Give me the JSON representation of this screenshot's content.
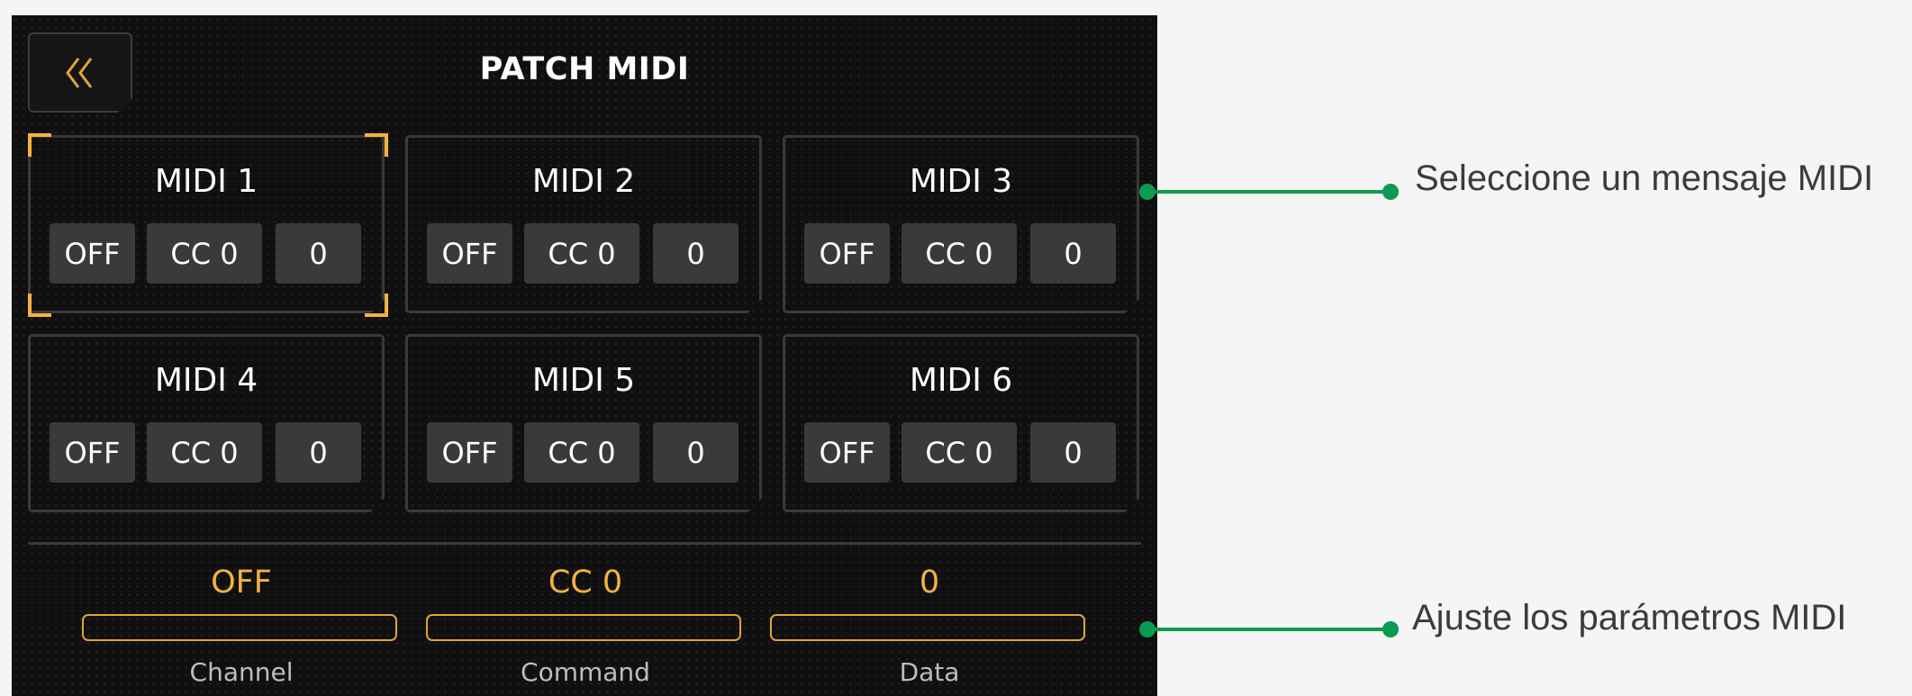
{
  "screen": {
    "title": "PATCH MIDI"
  },
  "blocks": [
    {
      "label": "MIDI 1",
      "channel": "OFF",
      "command": "CC 0",
      "data": "0"
    },
    {
      "label": "MIDI 2",
      "channel": "OFF",
      "command": "CC 0",
      "data": "0"
    },
    {
      "label": "MIDI 3",
      "channel": "OFF",
      "command": "CC 0",
      "data": "0"
    },
    {
      "label": "MIDI 4",
      "channel": "OFF",
      "command": "CC 0",
      "data": "0"
    },
    {
      "label": "MIDI 5",
      "channel": "OFF",
      "command": "CC 0",
      "data": "0"
    },
    {
      "label": "MIDI 6",
      "channel": "OFF",
      "command": "CC 0",
      "data": "0"
    }
  ],
  "selected_block": "MIDI 1",
  "params": [
    {
      "value": "OFF",
      "label": "Channel"
    },
    {
      "value": "CC 0",
      "label": "Command"
    },
    {
      "value": "0",
      "label": "Data"
    }
  ],
  "callouts": {
    "select": "Seleccione un mensaje MIDI",
    "adjust": "Ajuste los parámetros MIDI"
  },
  "colors": {
    "accent": "#f4b23f",
    "screen_bg": "#101010",
    "chip_bg": "#3a3a3a",
    "callout": "#0a9a52",
    "page_bg": "#f5f5f5"
  },
  "icons": {
    "back": "double-chevron-left-icon"
  }
}
